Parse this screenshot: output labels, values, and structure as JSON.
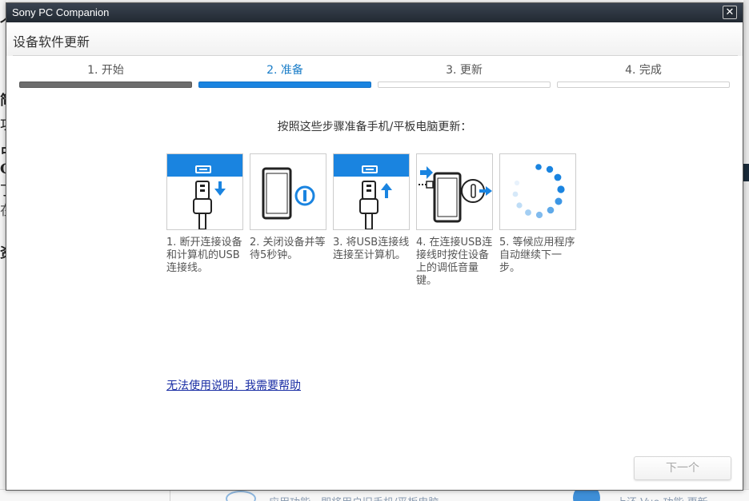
{
  "window": {
    "app_title": "Sony PC Companion",
    "close_glyph": "✕",
    "dialog_title": "设备软件更新"
  },
  "steps": [
    {
      "label": "1. 开始",
      "state": "done"
    },
    {
      "label": "2. 准备",
      "state": "active"
    },
    {
      "label": "3. 更新",
      "state": "pending"
    },
    {
      "label": "4. 完成",
      "state": "pending"
    }
  ],
  "instruction": "按照这些步骤准备手机/平板电脑更新：",
  "cards": [
    {
      "icon": "usb-disconnect-icon",
      "caption": "1. 断开连接设备和计算机的USB连接线。"
    },
    {
      "icon": "phone-power-off-icon",
      "caption": "2. 关闭设备并等待5秒钟。"
    },
    {
      "icon": "usb-connect-icon",
      "caption": "3. 将USB连接线连接至计算机。"
    },
    {
      "icon": "phone-volume-down-icon",
      "caption": "4. 在连接USB连接线时按住设备上的调低音量键。"
    },
    {
      "icon": "loading-spinner-icon",
      "caption": "5. 等候应用程序自动继续下一步。"
    }
  ],
  "help_link": "无法使用说明，我需要帮助",
  "next_button": "下一个",
  "colors": {
    "accent_blue": "#1a84e0",
    "done_gray": "#6d6d6d",
    "titlebar": "#2b323c",
    "link": "#1b2fa5"
  },
  "background": {
    "left_glyphs": [
      "个",
      "简",
      "功",
      "占",
      "C",
      "丁",
      "在",
      "资"
    ],
    "bottom_text_left": "应用功能，即将用户旧手机/平板电脑",
    "bottom_text_right": "上还 Vue 功能   更新"
  }
}
